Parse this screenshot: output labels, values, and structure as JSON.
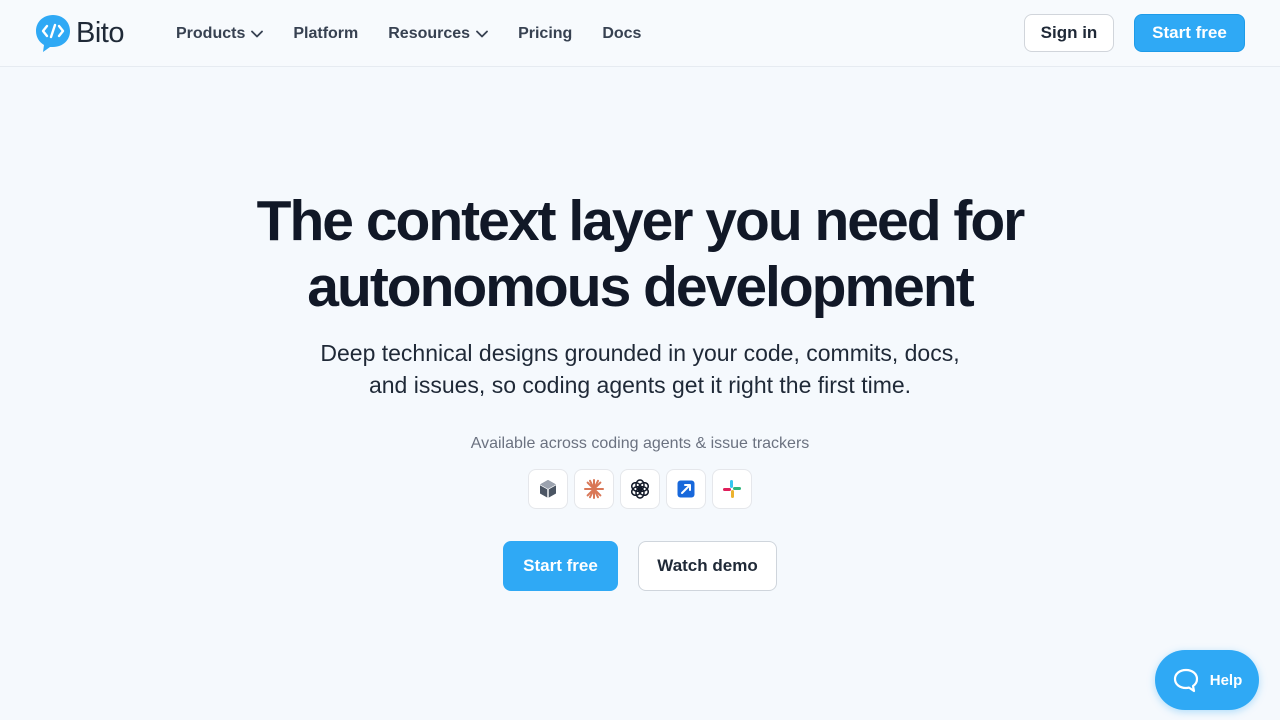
{
  "brand": {
    "name": "Bito",
    "accent": "#2fa9f5"
  },
  "nav": {
    "items": [
      {
        "label": "Products",
        "dropdown": true
      },
      {
        "label": "Platform",
        "dropdown": false
      },
      {
        "label": "Resources",
        "dropdown": true
      },
      {
        "label": "Pricing",
        "dropdown": false
      },
      {
        "label": "Docs",
        "dropdown": false
      }
    ],
    "signin_label": "Sign in",
    "startfree_label": "Start free"
  },
  "hero": {
    "title_line1": "The context layer you need for",
    "title_line2": "autonomous development",
    "subtitle_line1": "Deep technical designs grounded in your code, commits, docs,",
    "subtitle_line2": "and issues, so coding agents get it right the first time.",
    "available_text": "Available across coding agents & issue trackers",
    "integrations": [
      "cube-icon",
      "claude-icon",
      "openai-icon",
      "jira-icon",
      "slack-icon"
    ],
    "cta_primary": "Start free",
    "cta_secondary": "Watch demo"
  },
  "help_widget": {
    "label": "Help"
  }
}
